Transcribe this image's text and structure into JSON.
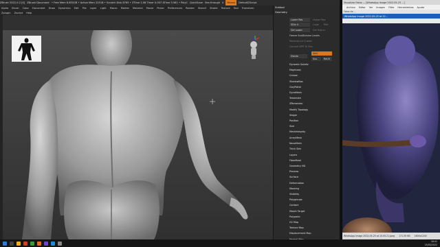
{
  "zbrush": {
    "title_items": [
      "ZBrush 2022.0.2 [S]",
      "ZBrush Document",
      "• Free Mem 6.855GB • Active Mem 22518 • Scratch Disk 8765 • ZTime 2.08 Timer 0.007 ATime 5.581 • PolyC",
      "QuickSave",
      "See-through",
      "0",
      "Menus",
      "DefaultZScript"
    ],
    "menu_row1": [
      "Alpha",
      "Brush",
      "Color",
      "Document",
      "Draw",
      "Dynamics",
      "Edit",
      "File",
      "Layer",
      "Light",
      "Macro",
      "Marker",
      "Material",
      "Movie",
      "Picker",
      "Preferences",
      "Render",
      "Stencil",
      "Stroke",
      "Texture",
      "Tool",
      "Transform"
    ],
    "menu_row2": [
      "Zplugin",
      "Zscript",
      "Help"
    ],
    "palette": {
      "header": "Subtool",
      "geometry_label": "Geometry",
      "lower_res": "Lower Res",
      "higher_res": "Higher Res",
      "sdiv": "SDiv 4",
      "cage": "Cage",
      "rstr": "Rstr",
      "del_lower": "Del Lower",
      "del_higher": "Del Higher",
      "freeze": "Freeze SubDivision Levels",
      "reconstruct": "Reconstruct Subdiv",
      "convert_bpr": "Convert BPR To Geo",
      "divide": "Divide",
      "smt": "Smt",
      "suv": "Suv",
      "reuv": "ReUV",
      "items_top": [
        "Dynamic Subdiv",
        "EdgeLoop",
        "Crease",
        "ShadowBox",
        "ClayPolish",
        "DynaMesh",
        "Tessimate",
        "ZRemesher",
        "Modify Topology",
        "Stager",
        "Position",
        "Size",
        "MeshIntegrity"
      ],
      "items_bottom": [
        "ArrayMesh",
        "NanoMesh",
        "Thick Skin",
        "Layers",
        "FiberMesh",
        "Geometry HD",
        "Preview",
        "Surface",
        "Deformation",
        "Masking",
        "Visibility",
        "Polygroups",
        "Contact",
        "Morph Target",
        "Polypaint",
        "UV Map",
        "Texture Map",
        "Displacement Map",
        "Normal Map"
      ]
    }
  },
  "viewer": {
    "title": "Visualizar Fotos — [WhatsApp Image 2022-05-25 ...]",
    "menu": [
      "Archivo",
      "Editar",
      "Ver",
      "Imagen",
      "Filtro",
      "Herramientas",
      "Ayuda"
    ],
    "breadcrumb": "Fotos de ...",
    "active_tab": "WhatsApp Image 2022-05-25 at 12...",
    "status_file": "WhatsApp Image 2022-05-25 at 10.05.21.jpeg",
    "status_size": "171.55 KB",
    "status_dims": "1600x1200"
  },
  "taskbar": {
    "time": "18:41",
    "date": "25/05/2022"
  },
  "colors": {
    "accent": "#e07a1f",
    "viewer_blue": "#1e5fb8"
  }
}
